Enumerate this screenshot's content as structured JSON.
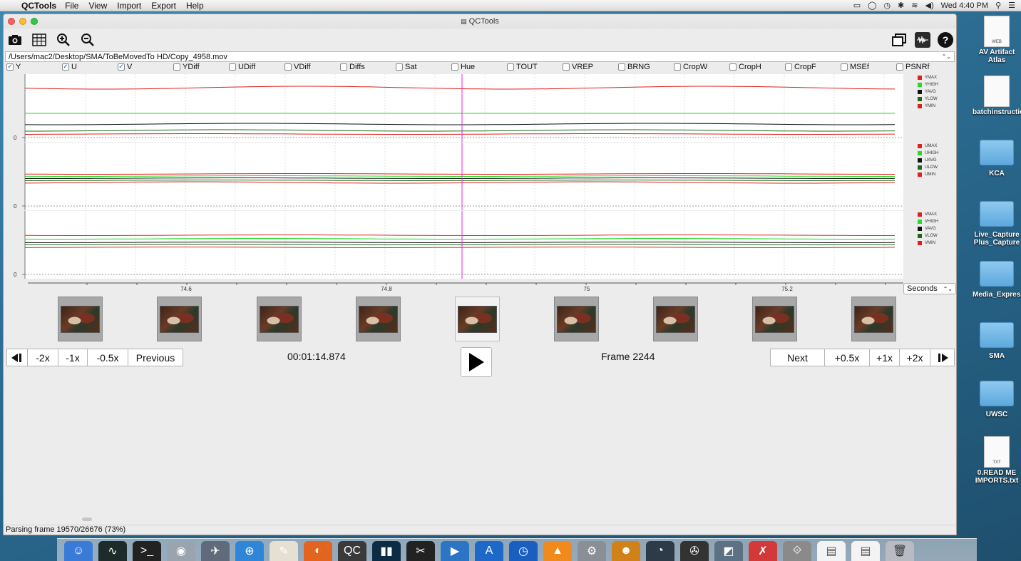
{
  "menubar": {
    "app_name": "QCTools",
    "menus": [
      "File",
      "View",
      "Import",
      "Export",
      "Help"
    ],
    "clock": "Wed 4:40 PM"
  },
  "window": {
    "title": "QCTools"
  },
  "file": {
    "path": "/Users/mac2/Desktop/SMA/ToBeMovedTo HD/Copy_4958.mov"
  },
  "filters": [
    {
      "label": "Y",
      "checked": true
    },
    {
      "label": "U",
      "checked": true
    },
    {
      "label": "V",
      "checked": true
    },
    {
      "label": "YDiff",
      "checked": false
    },
    {
      "label": "UDiff",
      "checked": false
    },
    {
      "label": "VDiff",
      "checked": false
    },
    {
      "label": "Diffs",
      "checked": false
    },
    {
      "label": "Sat",
      "checked": false
    },
    {
      "label": "Hue",
      "checked": false
    },
    {
      "label": "TOUT",
      "checked": false
    },
    {
      "label": "VREP",
      "checked": false
    },
    {
      "label": "BRNG",
      "checked": false
    },
    {
      "label": "CropW",
      "checked": false
    },
    {
      "label": "CropH",
      "checked": false
    },
    {
      "label": "CropF",
      "checked": false
    },
    {
      "label": "MSEf",
      "checked": false
    },
    {
      "label": "PSNRf",
      "checked": false
    }
  ],
  "plots": [
    {
      "name": "Y",
      "y_tick": "0",
      "legend": [
        "YMAX",
        "YHIGH",
        "YAVG",
        "YLOW",
        "YMIN"
      ]
    },
    {
      "name": "U",
      "y_tick": "0",
      "legend": [
        "UMAX",
        "UHIGH",
        "UAVG",
        "ULOW",
        "UMIN"
      ]
    },
    {
      "name": "V",
      "y_tick": "0",
      "legend": [
        "VMAX",
        "VHIGH",
        "VAVG",
        "VLOW",
        "VMIN"
      ]
    }
  ],
  "legend_colors": [
    "#e0201c",
    "#22dd22",
    "#111111",
    "#1a6a1a",
    "#e0201c"
  ],
  "x_axis": {
    "ticks": [
      "74.6",
      "74.8",
      "75",
      "75.2"
    ],
    "units": "Seconds"
  },
  "controls": {
    "first": "◀❚",
    "minus2": "-2x",
    "minus1": "-1x",
    "minus05": "-0.5x",
    "previous": "Previous",
    "timecode": "00:01:14.874",
    "frame": "Frame 2244",
    "next": "Next",
    "plus05": "+0.5x",
    "plus1": "+1x",
    "plus2": "+2x",
    "last": "❚▶"
  },
  "status": {
    "text": "Parsing frame 19570/26676 (73%)"
  },
  "desktop": {
    "icons": [
      {
        "label": "AV Artifact Atlas",
        "kind": "doc",
        "badge": "WEB"
      },
      {
        "label": "batchinstructions",
        "kind": "doc",
        "badge": ""
      },
      {
        "label": "KCA",
        "kind": "folder"
      },
      {
        "label": "Live_Capture Plus_Capture",
        "kind": "folder"
      },
      {
        "label": "Media_Express_Captures",
        "kind": "folder"
      },
      {
        "label": "SMA",
        "kind": "folder"
      },
      {
        "label": "UWSC",
        "kind": "folder"
      },
      {
        "label": "0.READ ME IMPORTS.txt",
        "kind": "doc",
        "badge": "TXT"
      }
    ]
  }
}
